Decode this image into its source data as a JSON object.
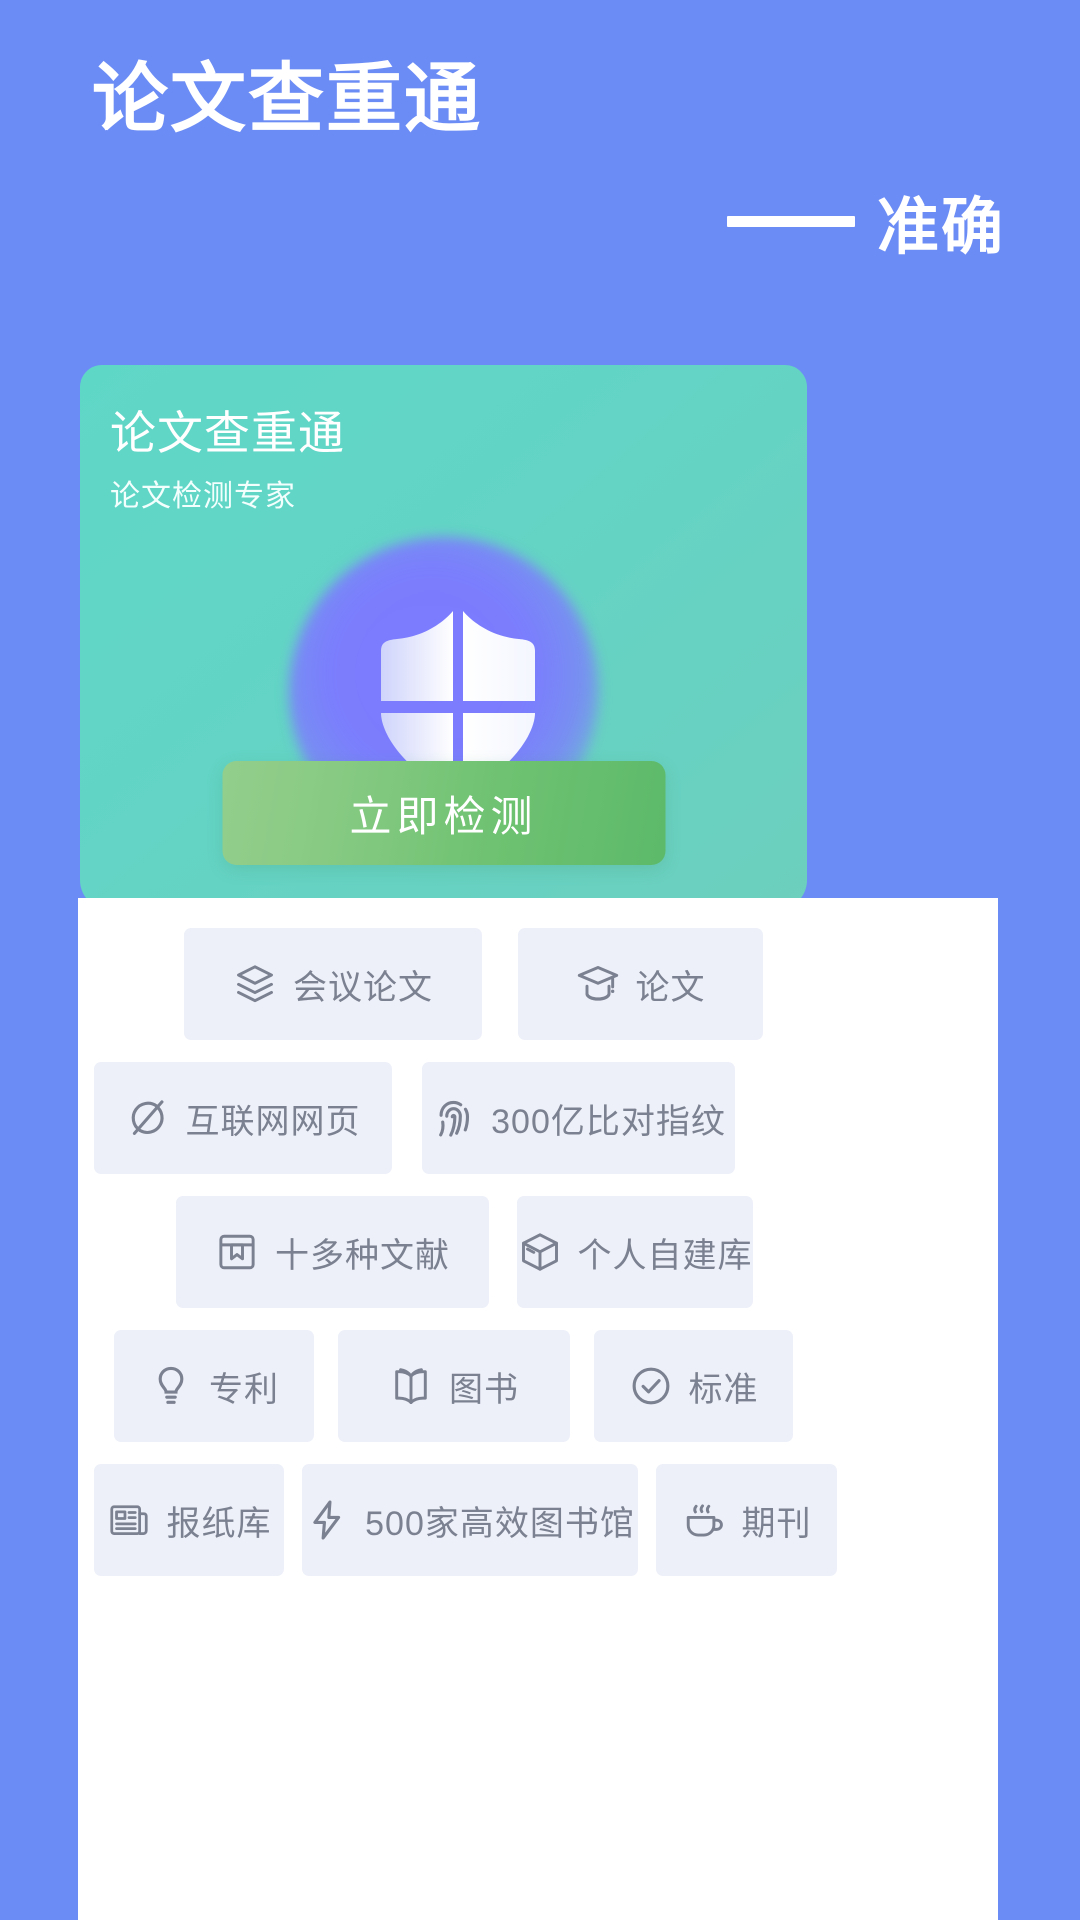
{
  "hero": {
    "title": "论文查重通",
    "dash": "——",
    "subtitle": "准确"
  },
  "card": {
    "title": "论文查重通",
    "subtitle": "论文检测专家",
    "shield_icon": "shield-check-icon",
    "cta_label": "立即检测",
    "bg_color": "#5fd7c7",
    "cta_color": "#6ec271",
    "glow_color": "#7d7bff"
  },
  "features": {
    "rows": [
      [
        {
          "label": "会议论文",
          "icon": "layers-icon"
        },
        {
          "label": "论文",
          "icon": "graduation-cap-icon"
        }
      ],
      [
        {
          "label": "互联网网页",
          "icon": "globe-icon"
        },
        {
          "label": "300亿比对指纹",
          "icon": "fingerprint-icon"
        }
      ],
      [
        {
          "label": "十多种文献",
          "icon": "bookmark-doc-icon"
        },
        {
          "label": "个人自建库",
          "icon": "box-icon"
        }
      ],
      [
        {
          "label": "专利",
          "icon": "lightbulb-icon"
        },
        {
          "label": "图书",
          "icon": "open-book-icon"
        },
        {
          "label": "标准",
          "icon": "check-circle-icon"
        }
      ],
      [
        {
          "label": "报纸库",
          "icon": "newspaper-icon"
        },
        {
          "label": "500家高效图书馆",
          "icon": "lightning-icon"
        },
        {
          "label": "期刊",
          "icon": "coffee-cup-icon"
        }
      ]
    ]
  },
  "colors": {
    "page_bg": "#6b8cf5",
    "chip_bg": "#eef0f9",
    "chip_text": "#7b8190"
  }
}
